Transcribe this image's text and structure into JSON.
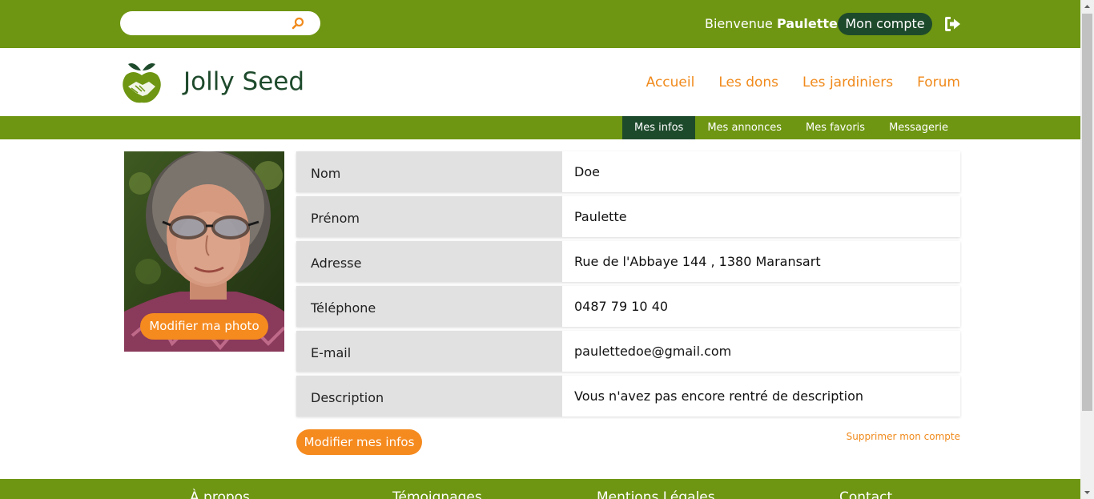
{
  "topbar": {
    "search_placeholder": "",
    "welcome_prefix": "Bienvenue",
    "welcome_name": "Paulette",
    "account_label": "Mon compte",
    "search_icon": "search-icon",
    "logout_icon": "logout-icon"
  },
  "header": {
    "brand": "Jolly Seed",
    "logo_icon": "apple-handshake-logo",
    "nav": [
      "Accueil",
      "Les dons",
      "Les jardiniers",
      "Forum"
    ]
  },
  "subnav": {
    "items": [
      "Mes infos",
      "Mes annonces",
      "Mes favoris",
      "Messagerie"
    ],
    "active": "Mes infos"
  },
  "profile": {
    "photo_button": "Modifier ma photo",
    "rows": [
      {
        "label": "Nom",
        "value": "Doe"
      },
      {
        "label": "Prénom",
        "value": "Paulette"
      },
      {
        "label": "Adresse",
        "value": "Rue de l'Abbaye 144 , 1380 Maransart"
      },
      {
        "label": "Téléphone",
        "value": "0487 79 10 40"
      },
      {
        "label": "E-mail",
        "value": "paulettedoe@gmail.com"
      },
      {
        "label": "Description",
        "value": "Vous n'avez pas encore rentré de description"
      }
    ],
    "edit_button": "Modifier mes infos",
    "delete_link": "Supprimer mon compte"
  },
  "footer": {
    "items": [
      "À propos",
      "Témoignages",
      "Mentions Légales",
      "Contact"
    ]
  },
  "colors": {
    "green": "#6e9612",
    "dark_green": "#1e4a2c",
    "orange": "#f58a1f"
  }
}
